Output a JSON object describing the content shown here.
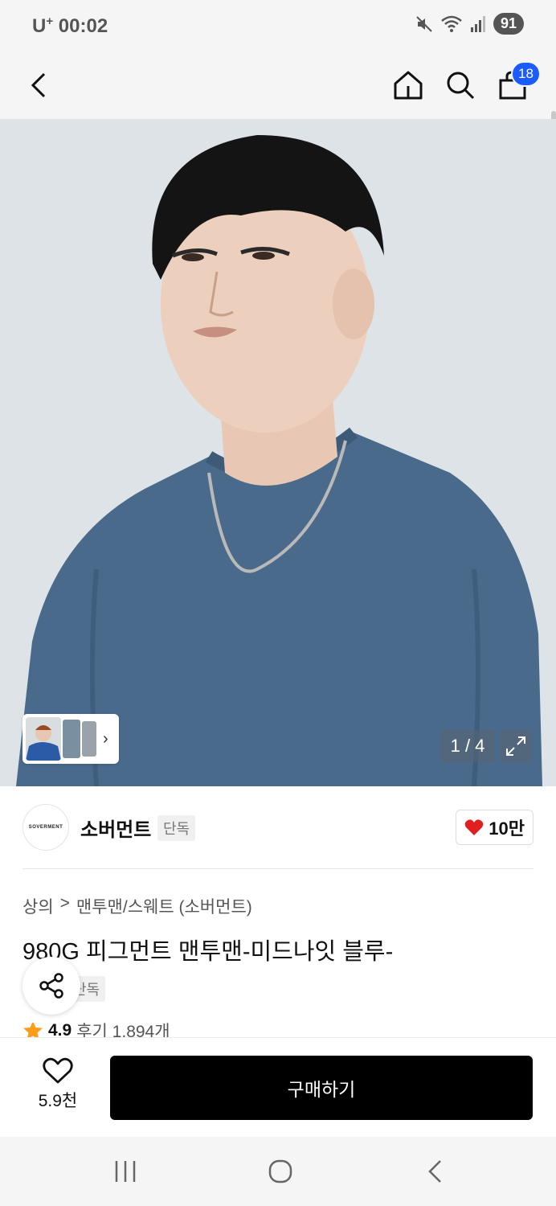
{
  "status_bar": {
    "carrier": "U",
    "carrier_sup": "+",
    "time": "00:02",
    "battery": "91"
  },
  "nav": {
    "cart_count": "18"
  },
  "hero": {
    "page_indicator": "1 / 4"
  },
  "brand": {
    "logo_text": "SOVERMENT",
    "name": "소버먼트",
    "tag": "단독",
    "likes": "10만"
  },
  "breadcrumb": {
    "category": "상의",
    "separator": ">",
    "subcategory": "맨투맨/스웨트 (소버먼트)"
  },
  "product": {
    "title": "980G 피그먼트 맨투맨-미드나잇 블루-",
    "tag": "단독",
    "rating": "4.9",
    "reviews": "후기 1,894개"
  },
  "action_bar": {
    "wish_count": "5.9천",
    "buy_label": "구매하기"
  },
  "colors": {
    "badge_blue": "#1a5cff",
    "heart_red": "#e02020",
    "star_orange": "#ff9c1a",
    "sweater_blue": "#4a6a8c"
  }
}
